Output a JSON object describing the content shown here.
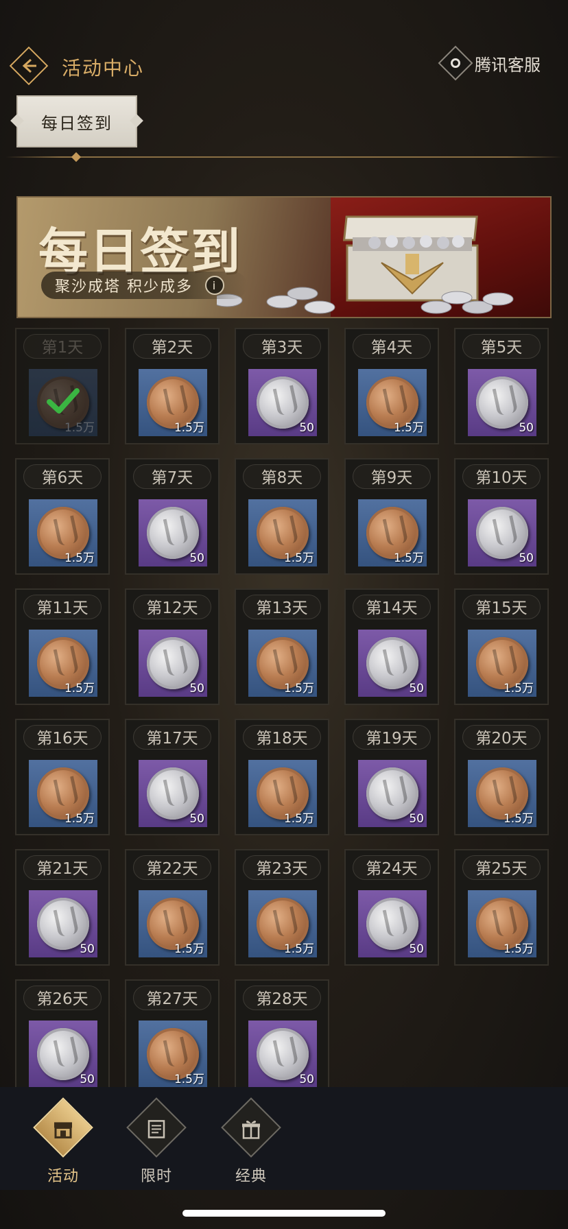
{
  "header": {
    "title": "活动中心",
    "service_label": "腾讯客服"
  },
  "tabs": [
    {
      "label": "每日签到",
      "active": true
    }
  ],
  "banner": {
    "title": "每日签到",
    "subtitle": "聚沙成塔 积少成多",
    "info_icon": "i"
  },
  "days": [
    {
      "label": "第1天",
      "reward": "bronze-coin",
      "amount": "1.5万",
      "claimed": true
    },
    {
      "label": "第2天",
      "reward": "bronze-coin",
      "amount": "1.5万",
      "claimed": false
    },
    {
      "label": "第3天",
      "reward": "silver-coin",
      "amount": "50",
      "claimed": false
    },
    {
      "label": "第4天",
      "reward": "bronze-coin",
      "amount": "1.5万",
      "claimed": false
    },
    {
      "label": "第5天",
      "reward": "silver-coin",
      "amount": "50",
      "claimed": false
    },
    {
      "label": "第6天",
      "reward": "bronze-coin",
      "amount": "1.5万",
      "claimed": false
    },
    {
      "label": "第7天",
      "reward": "silver-coin",
      "amount": "50",
      "claimed": false
    },
    {
      "label": "第8天",
      "reward": "bronze-coin",
      "amount": "1.5万",
      "claimed": false
    },
    {
      "label": "第9天",
      "reward": "bronze-coin",
      "amount": "1.5万",
      "claimed": false
    },
    {
      "label": "第10天",
      "reward": "silver-coin",
      "amount": "50",
      "claimed": false
    },
    {
      "label": "第11天",
      "reward": "bronze-coin",
      "amount": "1.5万",
      "claimed": false
    },
    {
      "label": "第12天",
      "reward": "silver-coin",
      "amount": "50",
      "claimed": false
    },
    {
      "label": "第13天",
      "reward": "bronze-coin",
      "amount": "1.5万",
      "claimed": false
    },
    {
      "label": "第14天",
      "reward": "silver-coin",
      "amount": "50",
      "claimed": false
    },
    {
      "label": "第15天",
      "reward": "bronze-coin",
      "amount": "1.5万",
      "claimed": false
    },
    {
      "label": "第16天",
      "reward": "bronze-coin",
      "amount": "1.5万",
      "claimed": false
    },
    {
      "label": "第17天",
      "reward": "silver-coin",
      "amount": "50",
      "claimed": false
    },
    {
      "label": "第18天",
      "reward": "bronze-coin",
      "amount": "1.5万",
      "claimed": false
    },
    {
      "label": "第19天",
      "reward": "silver-coin",
      "amount": "50",
      "claimed": false
    },
    {
      "label": "第20天",
      "reward": "bronze-coin",
      "amount": "1.5万",
      "claimed": false
    },
    {
      "label": "第21天",
      "reward": "silver-coin",
      "amount": "50",
      "claimed": false
    },
    {
      "label": "第22天",
      "reward": "bronze-coin",
      "amount": "1.5万",
      "claimed": false
    },
    {
      "label": "第23天",
      "reward": "bronze-coin",
      "amount": "1.5万",
      "claimed": false
    },
    {
      "label": "第24天",
      "reward": "silver-coin",
      "amount": "50",
      "claimed": false
    },
    {
      "label": "第25天",
      "reward": "bronze-coin",
      "amount": "1.5万",
      "claimed": false
    },
    {
      "label": "第26天",
      "reward": "silver-coin",
      "amount": "50",
      "claimed": false
    },
    {
      "label": "第27天",
      "reward": "bronze-coin",
      "amount": "1.5万",
      "claimed": false
    },
    {
      "label": "第28天",
      "reward": "silver-coin",
      "amount": "50",
      "claimed": false
    }
  ],
  "bottom_nav": [
    {
      "label": "活动",
      "icon": "shop-icon",
      "active": true
    },
    {
      "label": "限时",
      "icon": "calendar-icon",
      "active": false
    },
    {
      "label": "经典",
      "icon": "gift-icon",
      "active": false
    }
  ],
  "colors": {
    "accent_gold": "#d9ad67",
    "blue_tile": "#4563917",
    "purple_tile": "#6b4a97",
    "check_green": "#3fd14a"
  }
}
